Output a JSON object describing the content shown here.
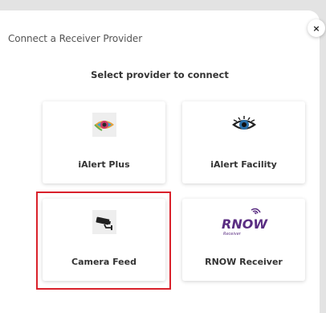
{
  "dialog": {
    "title": "Connect a Receiver Provider",
    "subtitle": "Select provider to connect",
    "close_glyph": "×"
  },
  "providers": [
    {
      "label": "iAlert Plus",
      "icon": "colorful-eye-icon"
    },
    {
      "label": "iAlert Facility",
      "icon": "eye-icon"
    },
    {
      "label": "Camera Feed",
      "icon": "security-camera-icon",
      "selected": true
    },
    {
      "label": "RNOW Receiver",
      "icon": "rnow-logo",
      "logo_text": "RNOW",
      "logo_subtext": "Receiver"
    }
  ],
  "colors": {
    "selection": "#d9212b",
    "logo": "#5a2d82"
  }
}
